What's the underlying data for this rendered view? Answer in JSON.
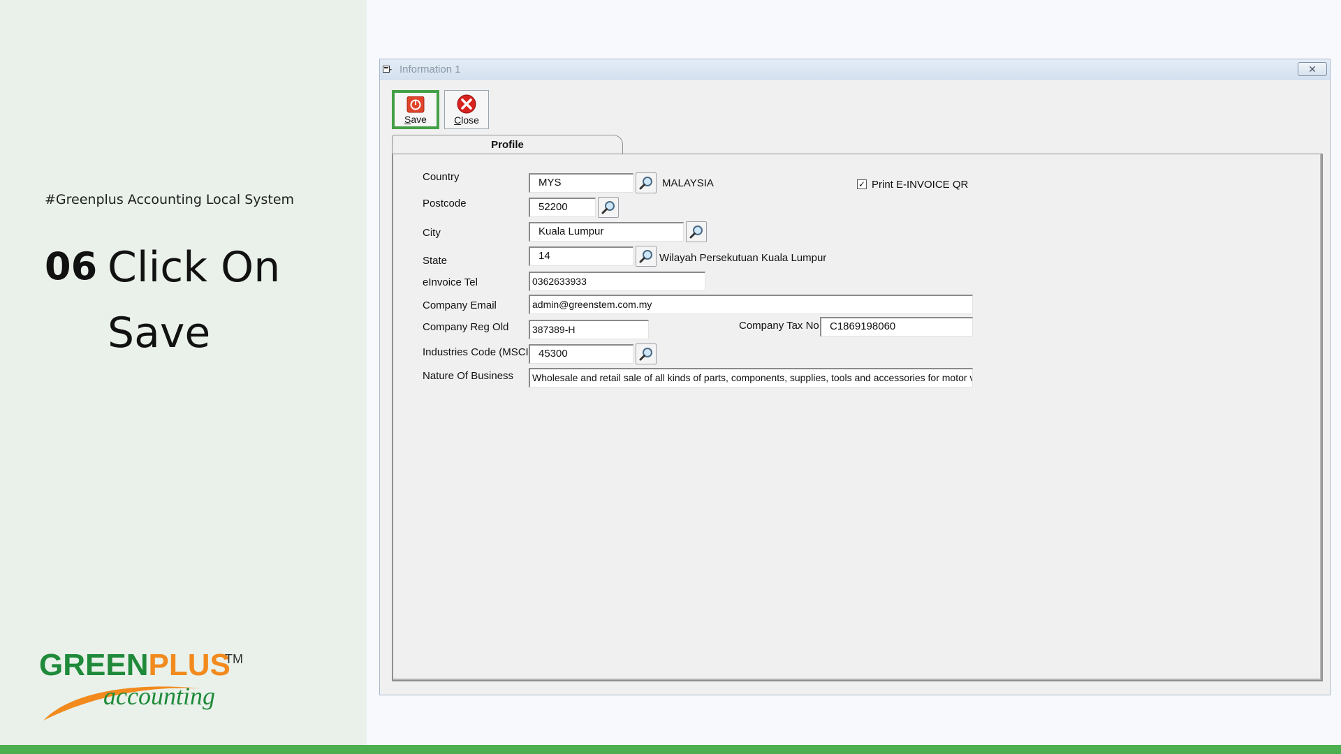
{
  "slide": {
    "hashtag": "#Greenplus Accounting Local System",
    "step_number": "06",
    "step_line1": "Click On",
    "step_line2": "Save"
  },
  "logo": {
    "green_part": "GREEN",
    "plus_part": "PLUS",
    "tm": "TM",
    "sub": "accounting"
  },
  "colors": {
    "brand_green": "#1f8a3a",
    "brand_orange": "#f28a1e",
    "highlight": "#43a047",
    "bottom_bar": "#4caf50"
  },
  "window": {
    "title": "Information 1",
    "close_glyph": "✕"
  },
  "toolbar": {
    "save_label": "Save",
    "save_mnemonic": "S",
    "save_rest": "ave",
    "close_label": "Close",
    "close_mnemonic": "C",
    "close_rest": "lose"
  },
  "tabs": [
    {
      "label": "Profile",
      "active": true
    }
  ],
  "form": {
    "country": {
      "label": "Country",
      "value": "MYS",
      "description": "MALAYSIA"
    },
    "postcode": {
      "label": "Postcode",
      "value": "52200"
    },
    "city": {
      "label": "City",
      "value": "Kuala Lumpur"
    },
    "state": {
      "label": "State",
      "value": "14",
      "description": "Wilayah Persekutuan Kuala Lumpur"
    },
    "einvoice_tel": {
      "label": "eInvoice Tel",
      "value": "0362633933"
    },
    "company_email": {
      "label": "Company Email",
      "value": "admin@greenstem.com.my"
    },
    "company_reg_old": {
      "label": "Company Reg Old",
      "value": "387389-H"
    },
    "company_tax_no": {
      "label": "Company Tax No",
      "value": "C1869198060"
    },
    "industries_code": {
      "label": "Industries Code (MSCI)",
      "value": "45300"
    },
    "nature_of_business": {
      "label": "Nature Of Business",
      "value": "Wholesale and retail sale of all kinds of parts, components, supplies, tools and accessories for motor vehic"
    },
    "print_einvoice_qr": {
      "label": "Print E-INVOICE QR",
      "checked": true,
      "check_glyph": "✓"
    }
  }
}
